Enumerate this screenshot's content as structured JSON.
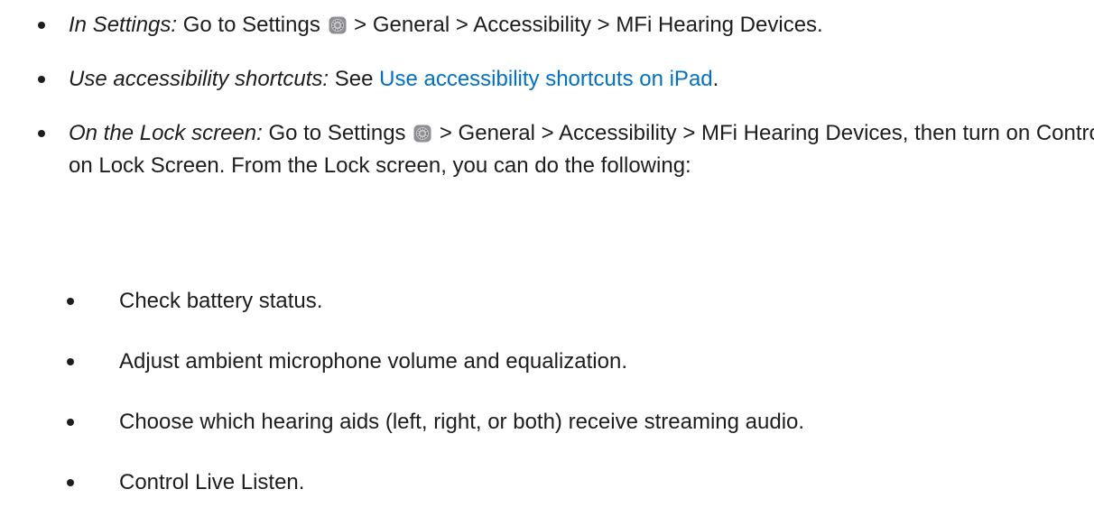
{
  "items": [
    {
      "lead": "In Settings:",
      "text_before_icon": " Go to Settings ",
      "icon": "settings-gear-icon",
      "text_after_icon": " > General > Accessibility > MFi Hearing Devices."
    },
    {
      "lead": "Use accessibility shortcuts:",
      "text_before_link": " See ",
      "link": "Use accessibility shortcuts on iPad",
      "text_after_link": "."
    },
    {
      "lead": "On the Lock screen:",
      "text_before_icon": " Go to Settings ",
      "icon": "settings-gear-icon",
      "text_after_icon": " > General > Accessibility > MFi Hearing Devices, then turn on Control on Lock Screen. From the Lock screen, you can do the following:"
    }
  ],
  "subitems": [
    "Check battery status.",
    "Adjust ambient microphone volume and equalization.",
    "Choose which hearing aids (left, right, or both) receive streaming audio.",
    "Control Live Listen."
  ],
  "colors": {
    "text": "#1d1d1f",
    "link": "#0070c9"
  }
}
